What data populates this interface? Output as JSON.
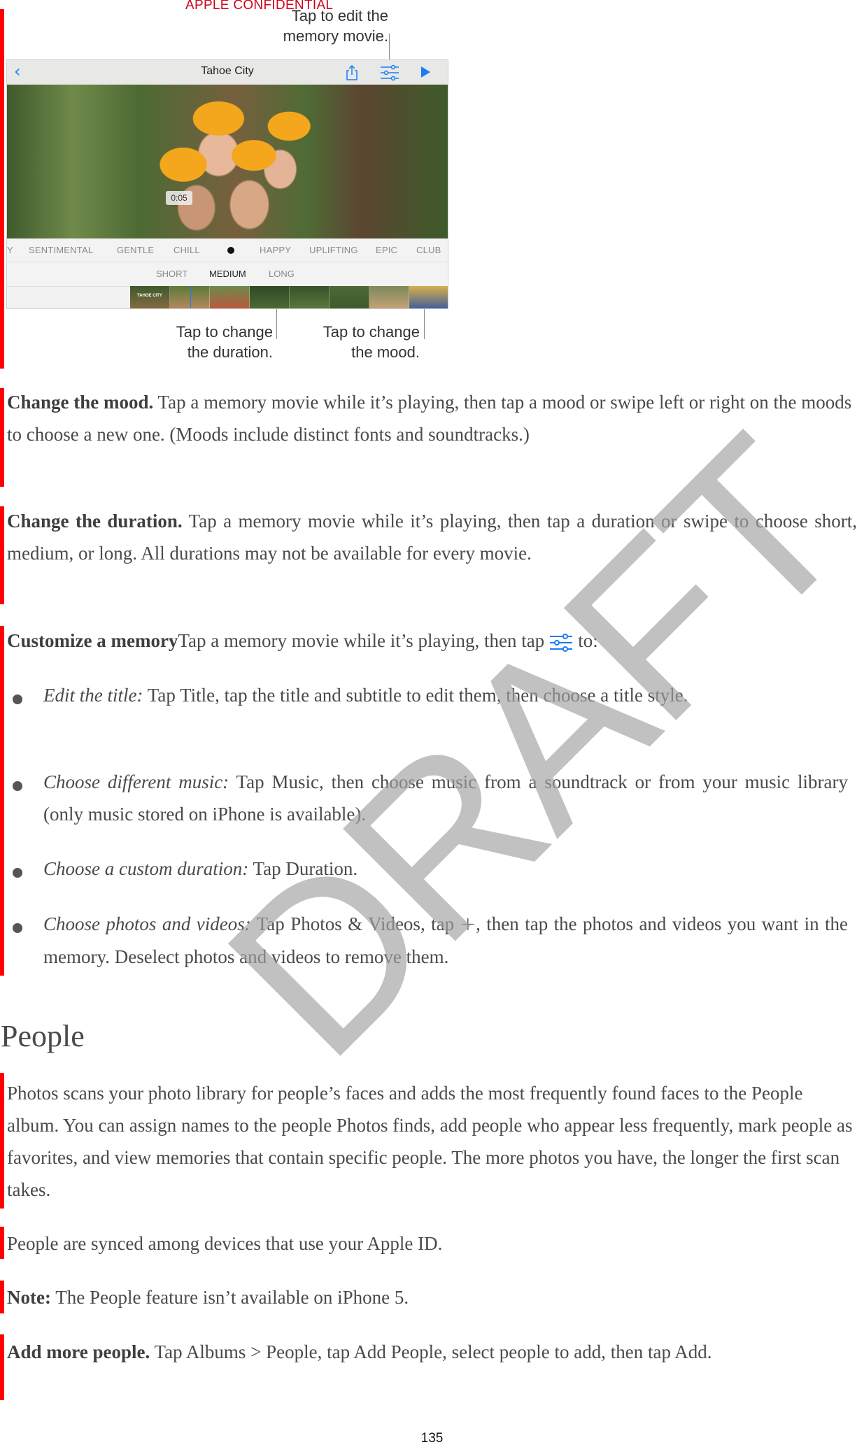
{
  "header": {
    "confidential_label": "APPLE CONFIDENTIAL"
  },
  "figure": {
    "callout_edit_line1": "Tap to edit the",
    "callout_edit_line2": "memory movie.",
    "callout_duration_line1": "Tap to change",
    "callout_duration_line2": "the duration.",
    "callout_mood_line1": "Tap to change",
    "callout_mood_line2": "the mood.",
    "app": {
      "title": "Tahoe City",
      "back_icon": "chevron-left-icon",
      "share_icon": "share-icon",
      "adjust_icon": "sliders-icon",
      "play_icon": "play-icon",
      "timestamp": "0:05",
      "moods": [
        "Y",
        "SENTIMENTAL",
        "GENTLE",
        "CHILL",
        "HAPPY",
        "UPLIFTING",
        "EPIC",
        "CLUB"
      ],
      "durations": [
        "SHORT",
        "MEDIUM",
        "LONG"
      ],
      "selected_duration": "MEDIUM",
      "filmstrip_title": "TAHOE CITY",
      "accent_color": "#1a7cf5"
    }
  },
  "sections": {
    "mood": {
      "lead": "Change the mood.",
      "text": " Tap a memory movie while it’s playing, then tap a mood or swipe left or right on the moods to choose a new one. (Moods include distinct fonts and soundtracks.)"
    },
    "duration": {
      "lead": "Change the duration.",
      "text": " Tap a memory movie while it’s playing, then tap a duration or swipe to choose short, medium, or long. All durations may not be available for every movie."
    },
    "customize": {
      "lead": "Customize a memory",
      "text_before_icon": "Tap a memory movie while it’s playing, then tap",
      "text_after_icon": "to:",
      "icon": "sliders-icon"
    },
    "bullets": [
      {
        "label": "Edit the title:",
        "text": " Tap Title, tap the title and subtitle to edit them, then choose a title style."
      },
      {
        "label": "Choose different music:",
        "text": " Tap Music, then choose music from a soundtrack or from your music library (only music stored on iPhone is available)."
      },
      {
        "label": "Choose a custom duration:",
        "text": " Tap Duration."
      },
      {
        "label": "Choose photos and videos:",
        "text_before_icon": " Tap Photos & Videos, tap ",
        "icon_glyph": "+",
        "text_after_icon": ", then tap the photos and videos you want in the memory. Deselect photos and videos to remove them."
      }
    ],
    "people_heading": "People",
    "people_intro": "Photos scans your photo library for people’s faces and adds the most frequently found faces to the People album. You can assign names to the people Photos finds, add people who appear less frequently, mark people as favorites, and view memories that contain specific people. The more photos you have, the longer the first scan takes.",
    "people_sync": "People are synced among devices that use your Apple ID.",
    "note": {
      "lead": "Note:",
      "text": " The People feature isn’t available on iPhone 5."
    },
    "add_people": {
      "lead": "Add more people.",
      "text": " Tap Albums > People, tap Add People, select people to add, then tap Add."
    }
  },
  "watermark": "DRAFT",
  "footer": {
    "page_number": "135"
  },
  "colors": {
    "change_bar": "#ff0000",
    "confidential": "#d0021b",
    "ios_blue": "#1a7cf5"
  }
}
